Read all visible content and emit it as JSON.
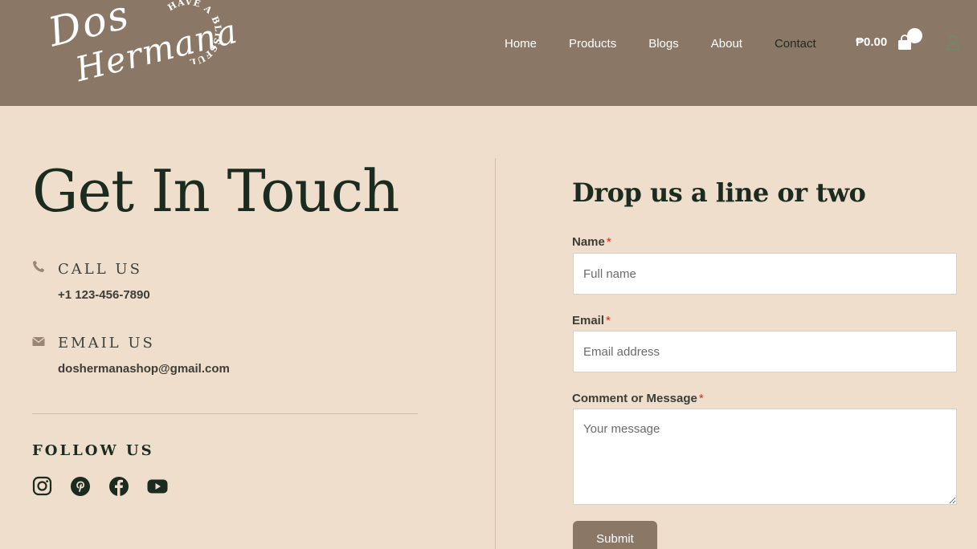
{
  "header": {
    "logo": {
      "script_line1": "Dos",
      "script_line2": "Hermana",
      "ring_text": "HAVE A BLISSFUL DAY"
    },
    "nav": [
      {
        "label": "Home",
        "active": false
      },
      {
        "label": "Products",
        "active": false
      },
      {
        "label": "Blogs",
        "active": false
      },
      {
        "label": "About",
        "active": false
      },
      {
        "label": "Contact",
        "active": true
      }
    ],
    "cart_total": "₱0.00",
    "icons": {
      "cart": "shopping-bag-icon",
      "user": "user-icon"
    }
  },
  "contact": {
    "title": "Get In Touch",
    "call": {
      "heading": "CALL US",
      "value": "+1 123-456-7890",
      "icon": "phone-icon"
    },
    "email": {
      "heading": "EMAIL US",
      "value": "doshermanashop@gmail.com",
      "icon": "envelope-icon"
    },
    "follow_heading": "FOLLOW US",
    "social": [
      "instagram-icon",
      "pinterest-icon",
      "facebook-icon",
      "youtube-icon"
    ]
  },
  "form": {
    "title": "Drop us a line or two",
    "required_mark": "*",
    "name": {
      "label": "Name",
      "placeholder": "Full name",
      "value": ""
    },
    "email": {
      "label": "Email",
      "placeholder": "Email address",
      "value": ""
    },
    "message": {
      "label": "Comment or Message",
      "placeholder": "Your message",
      "value": ""
    },
    "submit_label": "Submit"
  },
  "colors": {
    "header_bg": "#8b7765",
    "page_bg": "#efdecb",
    "heading": "#1b2b1f",
    "required": "#e0241c",
    "button_bg": "#8b7765"
  }
}
